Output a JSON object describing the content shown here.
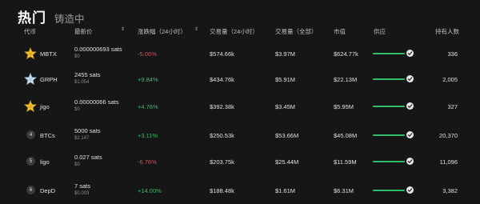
{
  "tabs": {
    "active": "热门",
    "other": "铸造中"
  },
  "columns": {
    "token": "代币",
    "price": "最新价",
    "change": "涨跌幅（24小时）",
    "vol24": "交易量（24小时）",
    "volAll": "交易量（全部）",
    "mcap": "市值",
    "supply": "供应",
    "holders": "持有人数"
  },
  "sort_icon": "⇕",
  "rows": [
    {
      "rank": "",
      "icon": "star-coin-gold-icon",
      "name": "MBTX",
      "price": "0.000000693 sats",
      "usd": "$0",
      "change": "-5.06%",
      "dir": "neg",
      "vol24": "$574.66k",
      "volAll": "$3.97M",
      "mcap": "$624.77k",
      "supply_fill": 1.0,
      "holders": "336"
    },
    {
      "rank": "",
      "icon": "star-coin-blue-icon",
      "name": "GRPH",
      "price": "2455 sats",
      "usd": "$1.054",
      "change": "+9.84%",
      "dir": "pos",
      "vol24": "$434.76k",
      "volAll": "$5.91M",
      "mcap": "$22.13M",
      "supply_fill": 1.0,
      "holders": "2,005"
    },
    {
      "rank": "",
      "icon": "star-coin-gold-icon",
      "name": "jigo",
      "price": "0.00000066 sats",
      "usd": "$0",
      "change": "+4.76%",
      "dir": "pos",
      "vol24": "$392.38k",
      "volAll": "$3.45M",
      "mcap": "$5.95M",
      "supply_fill": 1.0,
      "holders": "327"
    },
    {
      "rank": "4",
      "icon": "",
      "name": "BTCs",
      "price": "5000 sats",
      "usd": "$2.147",
      "change": "+3.11%",
      "dir": "pos",
      "vol24": "$250.53k",
      "volAll": "$53.66M",
      "mcap": "$45.08M",
      "supply_fill": 1.0,
      "holders": "20,370"
    },
    {
      "rank": "5",
      "icon": "",
      "name": "ligo",
      "price": "0.027 sats",
      "usd": "$0",
      "change": "-6.76%",
      "dir": "neg",
      "vol24": "$203.75k",
      "volAll": "$25.44M",
      "mcap": "$11.59M",
      "supply_fill": 1.0,
      "holders": "11,096"
    },
    {
      "rank": "6",
      "icon": "",
      "name": "DepD",
      "price": "7 sats",
      "usd": "$0.003",
      "change": "+14.00%",
      "dir": "pos",
      "vol24": "$188.48k",
      "volAll": "$1.61M",
      "mcap": "$6.31M",
      "supply_fill": 1.0,
      "holders": "3,382"
    }
  ],
  "colors": {
    "positive": "#2fbe6b",
    "negative": "#e14b4b",
    "bar": "#2fbe6b",
    "background": "#161616"
  }
}
